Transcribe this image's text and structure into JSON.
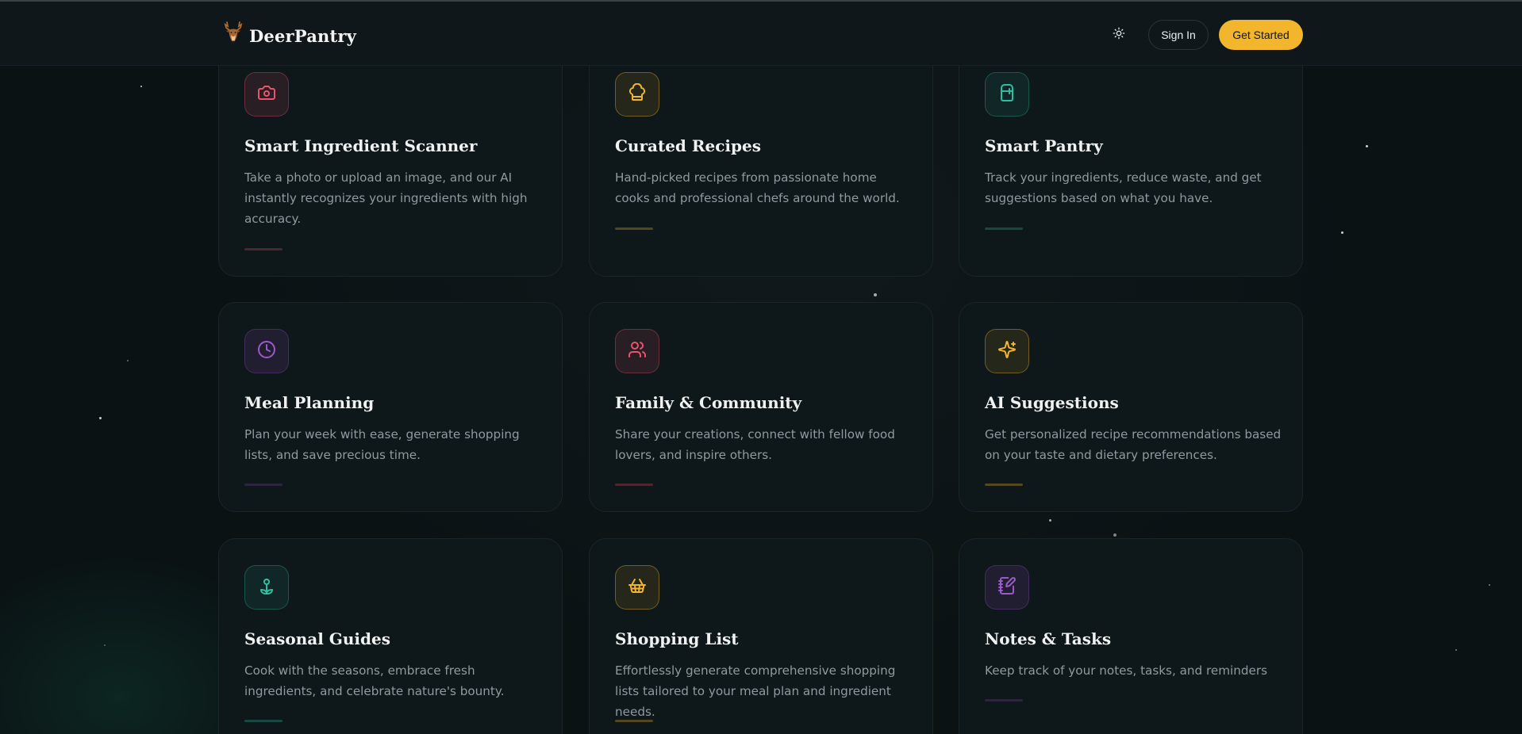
{
  "header": {
    "brand": "DeerPantry",
    "theme_toggle_icon": "sun-icon",
    "sign_in_label": "Sign In",
    "get_started_label": "Get Started",
    "accent_color": "#f1b62b"
  },
  "features": [
    {
      "title": "Smart Ingredient Scanner",
      "description": "Take a photo or upload an image, and our AI instantly recognizes your ingredients with high accuracy.",
      "icon": "camera-icon",
      "color": "#e8546c"
    },
    {
      "title": "Curated Recipes",
      "description": "Hand-picked recipes from passionate home cooks and professional chefs around the world.",
      "icon": "chef-hat-icon",
      "color": "#f1b62b"
    },
    {
      "title": "Smart Pantry",
      "description": "Track your ingredients, reduce waste, and get suggestions based on what you have.",
      "icon": "refrigerator-icon",
      "color": "#2dbea0"
    },
    {
      "title": "Meal Planning",
      "description": "Plan your week with ease, generate shopping lists, and save precious time.",
      "icon": "clock-icon",
      "color": "#9b59c9"
    },
    {
      "title": "Family & Community",
      "description": "Share your creations, connect with fellow food lovers, and inspire others.",
      "icon": "users-icon",
      "color": "#e8546c"
    },
    {
      "title": "AI Suggestions",
      "description": "Get personalized recipe recommendations based on your taste and dietary preferences.",
      "icon": "sparkles-icon",
      "color": "#f1b62b"
    },
    {
      "title": "Seasonal Guides",
      "description": "Cook with the seasons, embrace fresh ingredients, and celebrate nature's bounty.",
      "icon": "flower-icon",
      "color": "#2dbea0"
    },
    {
      "title": "Shopping List",
      "description": "Effortlessly generate comprehensive shopping lists tailored to your meal plan and ingredient needs.",
      "icon": "basket-icon",
      "color": "#f1b62b"
    },
    {
      "title": "Notes & Tasks",
      "description": "Keep track of your notes, tasks, and reminders",
      "icon": "notebook-pen-icon",
      "color": "#9b59c9"
    }
  ]
}
